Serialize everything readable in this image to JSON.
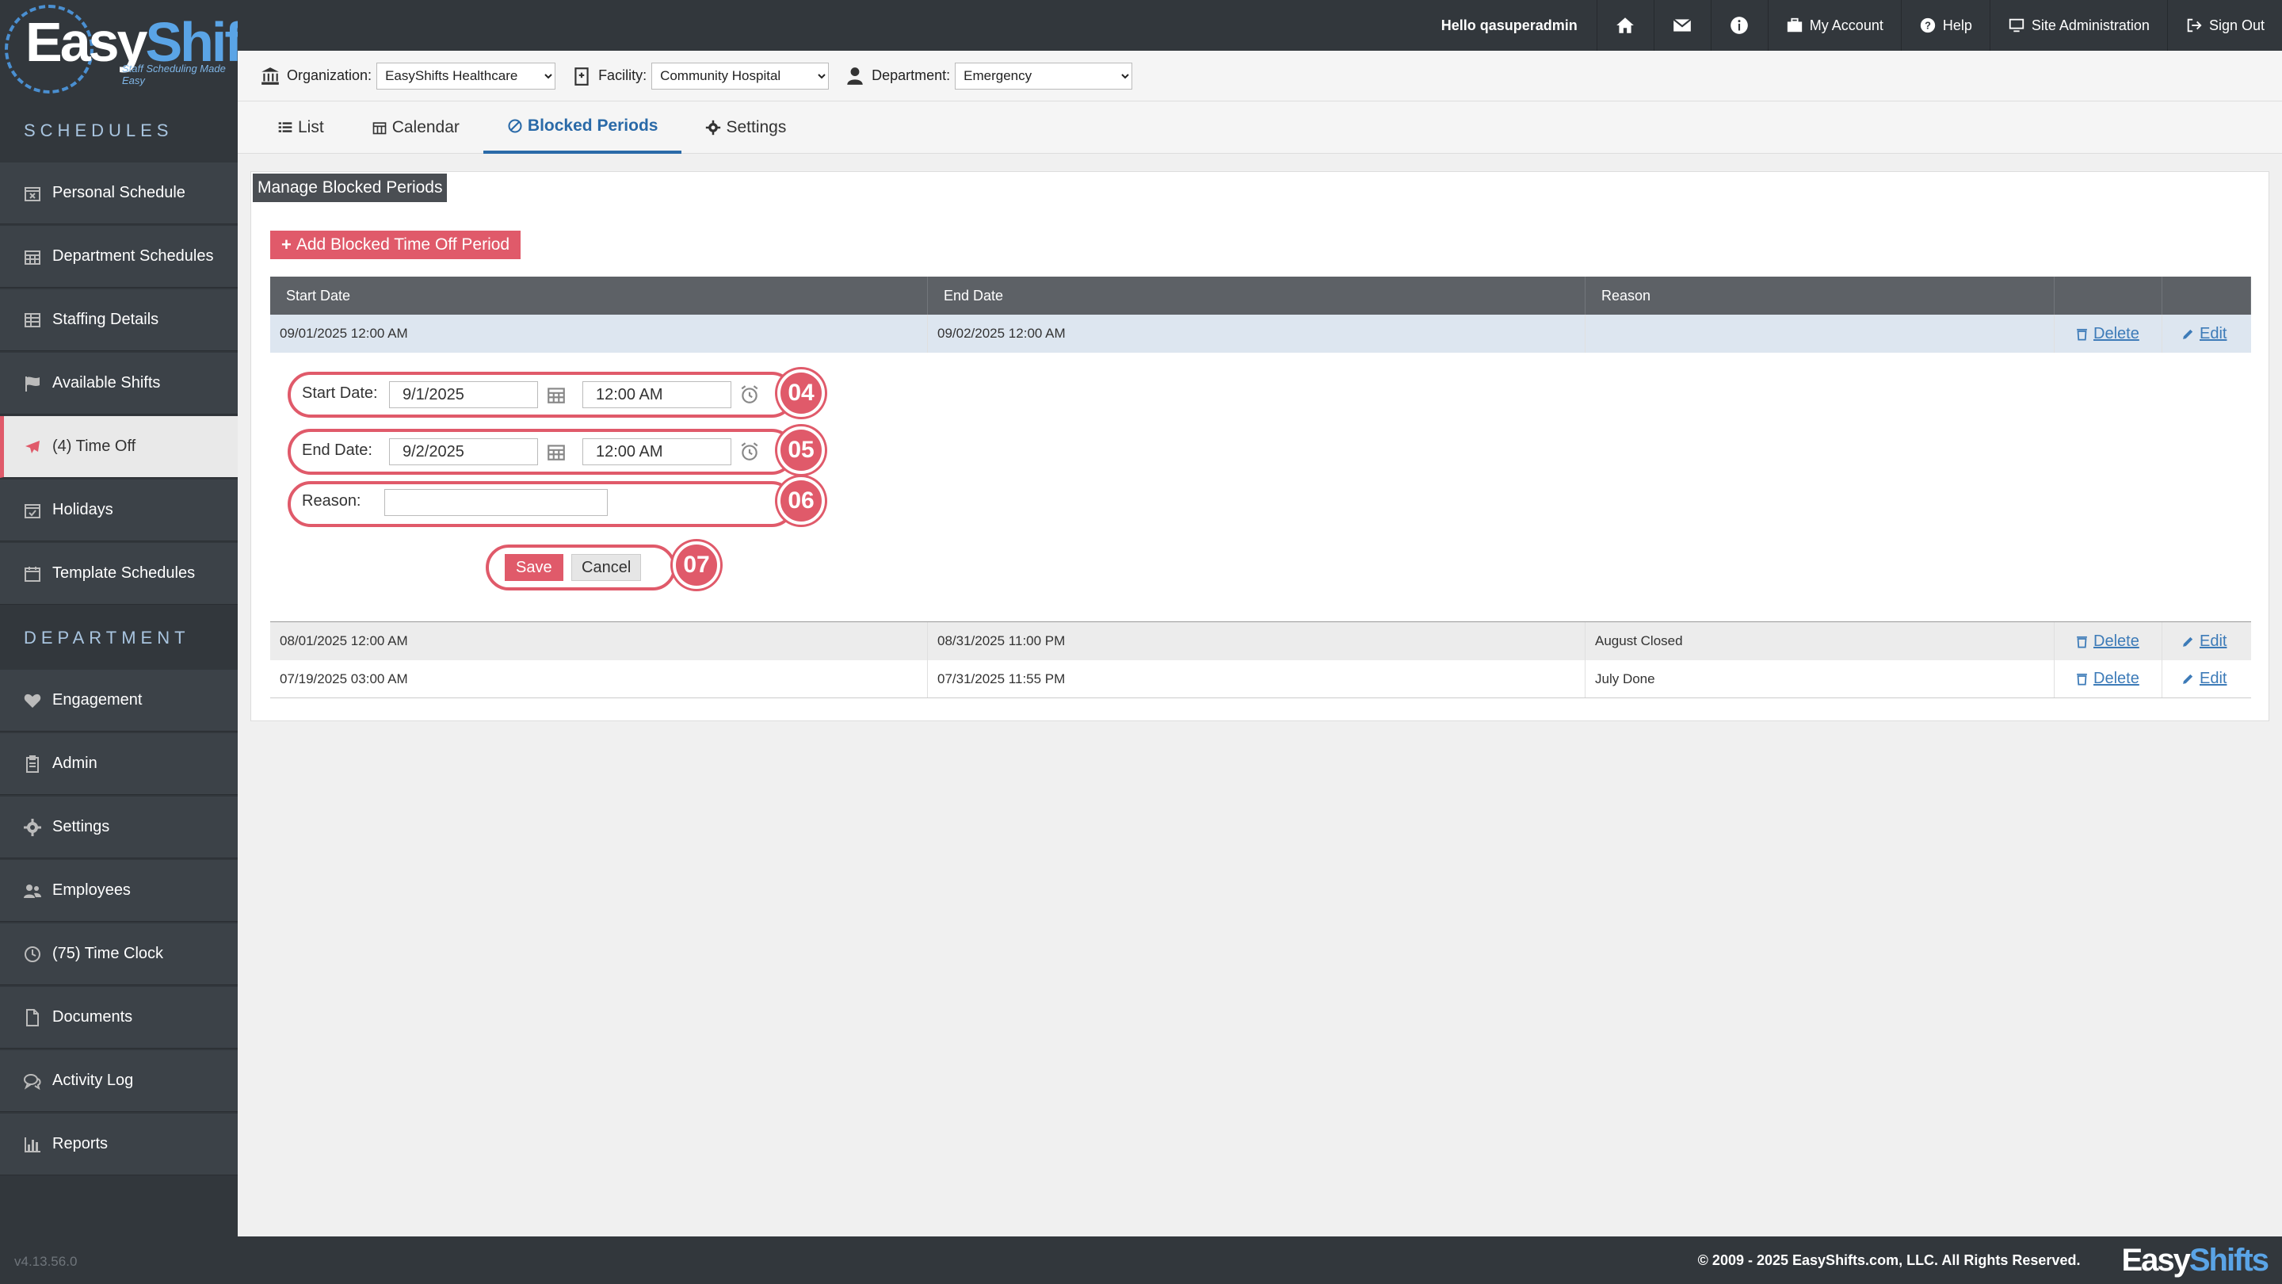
{
  "app": {
    "logo_easy": "Easy",
    "logo_shifts": "Shifts",
    "logo_tagline": "Staff Scheduling Made Easy",
    "version": "v4.13.56.0"
  },
  "sidebar": {
    "schedules_title": "SCHEDULES",
    "department_title": "DEPARTMENT",
    "schedules": [
      {
        "label": "Personal Schedule",
        "icon": "calendar-x-icon"
      },
      {
        "label": "Department Schedules",
        "icon": "calendar-grid-icon"
      },
      {
        "label": "Staffing Details",
        "icon": "table-icon"
      },
      {
        "label": "Available Shifts",
        "icon": "flag-icon"
      },
      {
        "label": "(4) Time Off",
        "icon": "plane-icon",
        "active": true
      },
      {
        "label": "Holidays",
        "icon": "calendar-check-icon"
      },
      {
        "label": "Template Schedules",
        "icon": "calendar-icon"
      }
    ],
    "department": [
      {
        "label": "Engagement",
        "icon": "heart-icon"
      },
      {
        "label": "Admin",
        "icon": "clipboard-icon"
      },
      {
        "label": "Settings",
        "icon": "gear-icon"
      },
      {
        "label": "Employees",
        "icon": "users-icon"
      },
      {
        "label": "(75) Time Clock",
        "icon": "clock-icon"
      },
      {
        "label": "Documents",
        "icon": "document-icon"
      },
      {
        "label": "Activity Log",
        "icon": "comments-icon"
      },
      {
        "label": "Reports",
        "icon": "bar-chart-icon"
      }
    ]
  },
  "topbar": {
    "hello": "Hello qasuperadmin",
    "my_account": "My Account",
    "help": "Help",
    "site_admin": "Site Administration",
    "sign_out": "Sign Out"
  },
  "filters": {
    "org_label": "Organization:",
    "org_value": "EasyShifts Healthcare",
    "facility_label": "Facility:",
    "facility_value": "Community Hospital",
    "dept_label": "Department:",
    "dept_value": "Emergency"
  },
  "tabs": [
    {
      "label": "List"
    },
    {
      "label": "Calendar"
    },
    {
      "label": "Blocked Periods",
      "active": true
    },
    {
      "label": "Settings"
    }
  ],
  "panel": {
    "title": "Manage Blocked Periods",
    "add_button": "Add Blocked Time Off Period"
  },
  "table": {
    "headers": [
      "Start Date",
      "End Date",
      "Reason",
      "",
      ""
    ],
    "delete_label": "Delete",
    "edit_label": "Edit",
    "rows": [
      {
        "start": "09/01/2025 12:00 AM",
        "end": "09/02/2025 12:00 AM",
        "reason": ""
      },
      {
        "start": "08/01/2025 12:00 AM",
        "end": "08/31/2025 11:00 PM",
        "reason": "August Closed"
      },
      {
        "start": "07/19/2025 03:00 AM",
        "end": "07/31/2025 11:55 PM",
        "reason": "July Done"
      }
    ]
  },
  "edit_form": {
    "start_label": "Start Date:",
    "start_date": "9/1/2025",
    "start_time": "12:00 AM",
    "end_label": "End Date:",
    "end_date": "9/2/2025",
    "end_time": "12:00 AM",
    "reason_label": "Reason:",
    "reason_value": "",
    "save": "Save",
    "cancel": "Cancel",
    "badges": [
      "04",
      "05",
      "06",
      "07"
    ]
  },
  "footer": {
    "copyright": "© 2009 - 2025 EasyShifts.com, LLC. All Rights Reserved."
  },
  "colors": {
    "accent": "#e05a6a",
    "link": "#3d7bb8",
    "dark": "#32373c"
  }
}
